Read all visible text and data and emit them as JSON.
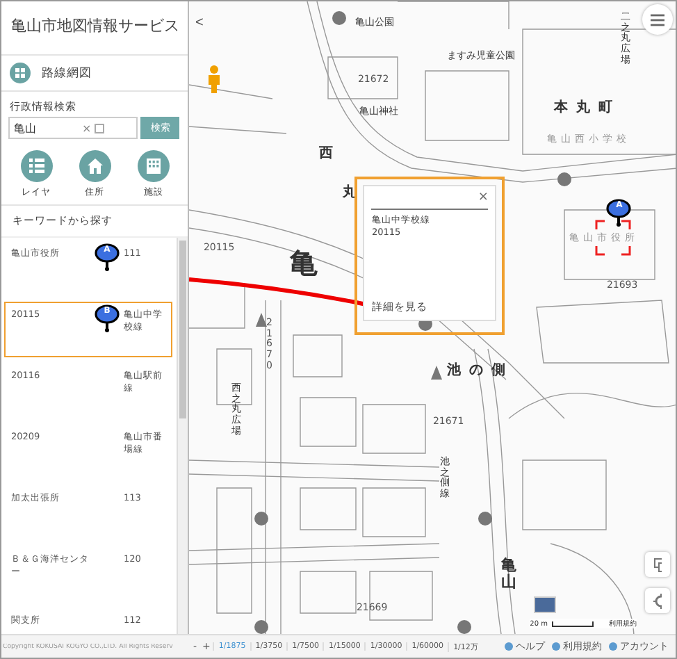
{
  "app_title": "亀山市地図情報サービス",
  "route_map_button": {
    "label": "路線網図"
  },
  "admin_search": {
    "label": "行政情報検索",
    "value": "亀山",
    "clear": "×",
    "button": "検索"
  },
  "quick_buttons": [
    {
      "label": "レイヤ",
      "kind": "list"
    },
    {
      "label": "住所",
      "kind": "house"
    },
    {
      "label": "施設",
      "kind": "building"
    }
  ],
  "keyword_heading": "キーワードから探す",
  "results": [
    {
      "name": "亀山市役所",
      "marker": "A",
      "code": "111",
      "selected": false
    },
    {
      "name": "20115",
      "marker": "B",
      "code": "亀山中学校線",
      "selected": true
    },
    {
      "name": "20116",
      "code": "亀山駅前線",
      "selected": false
    },
    {
      "name": "20209",
      "code": "亀山市番場線",
      "selected": false
    },
    {
      "name": "加太出張所",
      "code": "113",
      "selected": false
    },
    {
      "name": "Ｂ＆Ｇ海洋センター",
      "code": "120",
      "selected": false
    },
    {
      "name": "関支所",
      "code": "112",
      "selected": false
    }
  ],
  "copyright": "Copyright KOKUSAI KOGYO CO.,LTD. All Rights Reserv",
  "map_labels": [
    {
      "text": "亀山公園",
      "kind": "place"
    },
    {
      "text": "ますみ児童公園",
      "kind": "place"
    },
    {
      "text": "21672",
      "kind": "road"
    },
    {
      "text": "亀山神社",
      "kind": "place"
    },
    {
      "text": "本丸町",
      "kind": "town"
    },
    {
      "text": "亀山西小学校",
      "kind": "faded"
    },
    {
      "text": "西",
      "kind": "town"
    },
    {
      "text": "丸",
      "kind": "town"
    },
    {
      "text": "亀",
      "kind": "big"
    },
    {
      "text": "20115",
      "kind": "road"
    },
    {
      "text": "池の側",
      "kind": "town"
    },
    {
      "text": "21671",
      "kind": "road"
    },
    {
      "text": "21670",
      "kind": "vroad"
    },
    {
      "text": "西之丸広場",
      "kind": "vplace"
    },
    {
      "text": "池之側線",
      "kind": "vplace"
    },
    {
      "text": "二之丸広場",
      "kind": "vplace"
    },
    {
      "text": "亀山市役所",
      "kind": "faded"
    },
    {
      "text": "21693",
      "kind": "road"
    },
    {
      "text": "21669",
      "kind": "road"
    },
    {
      "text": "亀山",
      "kind": "vbig"
    }
  ],
  "map_marker": {
    "letter": "A"
  },
  "popup": {
    "title": "亀山中学校線",
    "code": "20115",
    "link": "詳細を見る",
    "close": "×"
  },
  "scale": {
    "label": "20 m",
    "terms": "利用規約"
  },
  "back_button": "<",
  "zoom_controls": [
    "-",
    "+"
  ],
  "zoom_levels": [
    {
      "label": "1/1875",
      "selected": true
    },
    {
      "label": "1/3750",
      "selected": false
    },
    {
      "label": "1/7500",
      "selected": false
    },
    {
      "label": "1/15000",
      "selected": false
    },
    {
      "label": "1/30000",
      "selected": false
    },
    {
      "label": "1/60000",
      "selected": false
    },
    {
      "label": "1/12万",
      "selected": false
    }
  ],
  "footer_links": [
    "ヘルプ",
    "利用規約",
    "アカウント"
  ]
}
